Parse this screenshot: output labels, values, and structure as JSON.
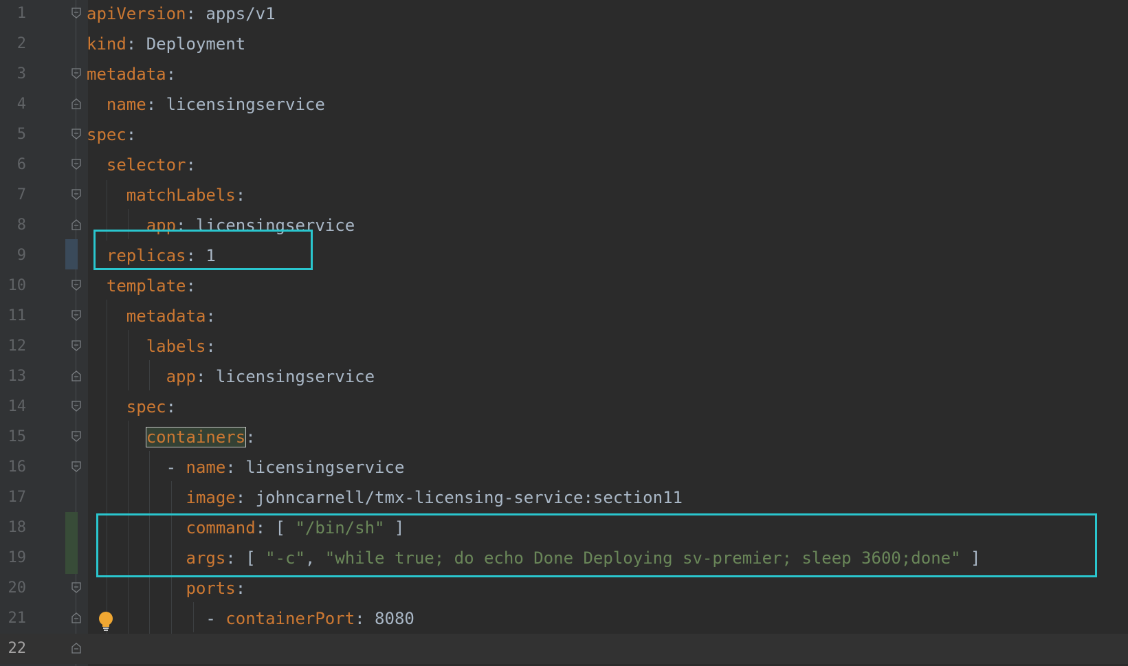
{
  "editor": {
    "current_line": 22,
    "lines": [
      {
        "n": "1",
        "tokens": [
          {
            "t": "apiVersion",
            "c": "k"
          },
          {
            "t": ": ",
            "c": "p"
          },
          {
            "t": "apps/v1",
            "c": "v"
          }
        ]
      },
      {
        "n": "2",
        "tokens": [
          {
            "t": "kind",
            "c": "k"
          },
          {
            "t": ": ",
            "c": "p"
          },
          {
            "t": "Deployment",
            "c": "v"
          }
        ]
      },
      {
        "n": "3",
        "tokens": [
          {
            "t": "metadata",
            "c": "k"
          },
          {
            "t": ":",
            "c": "p"
          }
        ]
      },
      {
        "n": "4",
        "tokens": [
          {
            "t": "  name",
            "c": "k"
          },
          {
            "t": ": ",
            "c": "p"
          },
          {
            "t": "licensingservice",
            "c": "v"
          }
        ]
      },
      {
        "n": "5",
        "tokens": [
          {
            "t": "spec",
            "c": "k"
          },
          {
            "t": ":",
            "c": "p"
          }
        ]
      },
      {
        "n": "6",
        "tokens": [
          {
            "t": "  selector",
            "c": "k"
          },
          {
            "t": ":",
            "c": "p"
          }
        ]
      },
      {
        "n": "7",
        "tokens": [
          {
            "t": "    matchLabels",
            "c": "k"
          },
          {
            "t": ":",
            "c": "p"
          }
        ]
      },
      {
        "n": "8",
        "tokens": [
          {
            "t": "      app",
            "c": "k"
          },
          {
            "t": ": ",
            "c": "p"
          },
          {
            "t": "licensingservice",
            "c": "v"
          }
        ]
      },
      {
        "n": "9",
        "tokens": [
          {
            "t": "  replicas",
            "c": "k"
          },
          {
            "t": ": ",
            "c": "p"
          },
          {
            "t": "1",
            "c": "v"
          }
        ]
      },
      {
        "n": "10",
        "tokens": [
          {
            "t": "  template",
            "c": "k"
          },
          {
            "t": ":",
            "c": "p"
          }
        ]
      },
      {
        "n": "11",
        "tokens": [
          {
            "t": "    metadata",
            "c": "k"
          },
          {
            "t": ":",
            "c": "p"
          }
        ]
      },
      {
        "n": "12",
        "tokens": [
          {
            "t": "      labels",
            "c": "k"
          },
          {
            "t": ":",
            "c": "p"
          }
        ]
      },
      {
        "n": "13",
        "tokens": [
          {
            "t": "        app",
            "c": "k"
          },
          {
            "t": ": ",
            "c": "p"
          },
          {
            "t": "licensingservice",
            "c": "v"
          }
        ]
      },
      {
        "n": "14",
        "tokens": [
          {
            "t": "    spec",
            "c": "k"
          },
          {
            "t": ":",
            "c": "p"
          }
        ]
      },
      {
        "n": "15",
        "tokens": [
          {
            "t": "      ",
            "c": "p"
          },
          {
            "t": "containers",
            "c": "k hl"
          },
          {
            "t": ":",
            "c": "p"
          }
        ]
      },
      {
        "n": "16",
        "tokens": [
          {
            "t": "        - ",
            "c": "p"
          },
          {
            "t": "name",
            "c": "k"
          },
          {
            "t": ": ",
            "c": "p"
          },
          {
            "t": "licensingservice",
            "c": "v"
          }
        ]
      },
      {
        "n": "17",
        "tokens": [
          {
            "t": "          image",
            "c": "k"
          },
          {
            "t": ": ",
            "c": "p"
          },
          {
            "t": "johncarnell/tmx-licensing-service:section11",
            "c": "v"
          }
        ]
      },
      {
        "n": "18",
        "tokens": [
          {
            "t": "          command",
            "c": "k"
          },
          {
            "t": ": [ ",
            "c": "p"
          },
          {
            "t": "\"/bin/sh\"",
            "c": "s"
          },
          {
            "t": " ]",
            "c": "p"
          }
        ]
      },
      {
        "n": "19",
        "tokens": [
          {
            "t": "          args",
            "c": "k"
          },
          {
            "t": ": [ ",
            "c": "p"
          },
          {
            "t": "\"-c\"",
            "c": "s"
          },
          {
            "t": ", ",
            "c": "p"
          },
          {
            "t": "\"while true; do echo Done Deploying sv-premier; sleep 3600;done\"",
            "c": "s"
          },
          {
            "t": " ]",
            "c": "p"
          }
        ]
      },
      {
        "n": "20",
        "tokens": [
          {
            "t": "          ports",
            "c": "k"
          },
          {
            "t": ":",
            "c": "p"
          }
        ]
      },
      {
        "n": "21",
        "tokens": [
          {
            "t": "            - ",
            "c": "p"
          },
          {
            "t": "containerPort",
            "c": "k"
          },
          {
            "t": ": ",
            "c": "p"
          },
          {
            "t": "8080",
            "c": "v"
          }
        ]
      },
      {
        "n": "22",
        "tokens": []
      }
    ]
  },
  "colors": {
    "background": "#2b2b2b",
    "key": "#cc7832",
    "value": "#a9b7c6",
    "string": "#6a8759",
    "annotation_box": "#2ac6ce"
  },
  "icons": {
    "fold_marker": "fold-marker-icon",
    "intention": "lightbulb-icon"
  }
}
